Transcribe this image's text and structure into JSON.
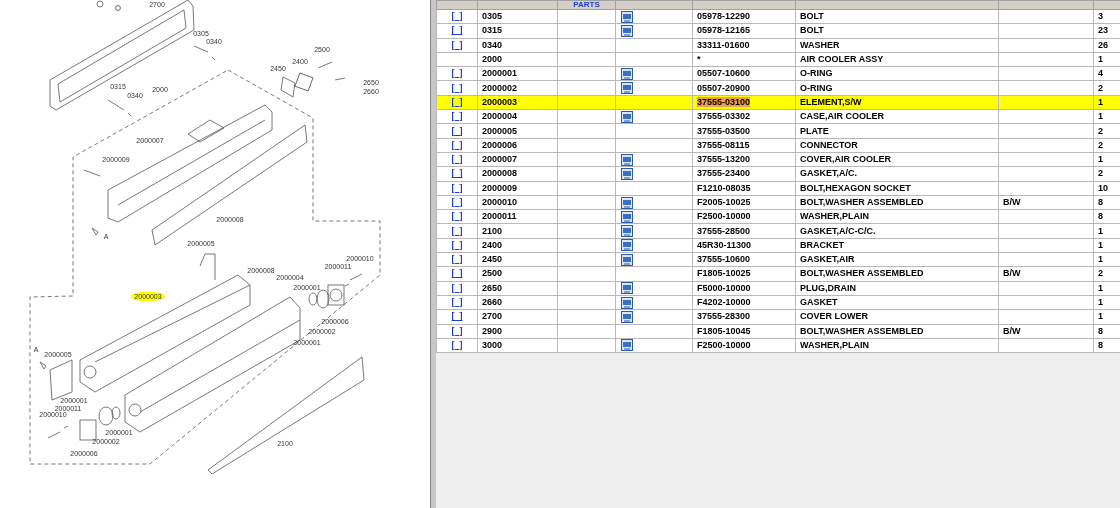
{
  "diagram": {
    "callouts": [
      {
        "label": "2700",
        "selected": false
      },
      {
        "label": "0305",
        "selected": false
      },
      {
        "label": "0340",
        "selected": false
      },
      {
        "label": "2500",
        "selected": false
      },
      {
        "label": "2400",
        "selected": false
      },
      {
        "label": "2450",
        "selected": false
      },
      {
        "label": "2650",
        "selected": false
      },
      {
        "label": "2660",
        "selected": false
      },
      {
        "label": "0315",
        "selected": false
      },
      {
        "label": "0340",
        "selected": false
      },
      {
        "label": "2000",
        "selected": false
      },
      {
        "label": "2000007",
        "selected": false
      },
      {
        "label": "2000009",
        "selected": false
      },
      {
        "label": "2000008",
        "selected": false
      },
      {
        "label": "A",
        "selected": false
      },
      {
        "label": "2000005",
        "selected": false
      },
      {
        "label": "2000010",
        "selected": false
      },
      {
        "label": "2000011",
        "selected": false
      },
      {
        "label": "2000008",
        "selected": false
      },
      {
        "label": "2000004",
        "selected": false
      },
      {
        "label": "2000001",
        "selected": false
      },
      {
        "label": "2000003",
        "selected": true
      },
      {
        "label": "2000006",
        "selected": false
      },
      {
        "label": "2000002",
        "selected": false
      },
      {
        "label": "2000001",
        "selected": false
      },
      {
        "label": "A",
        "selected": false
      },
      {
        "label": "2000005",
        "selected": false
      },
      {
        "label": "2000001",
        "selected": false
      },
      {
        "label": "2000011",
        "selected": false
      },
      {
        "label": "2000010",
        "selected": false
      },
      {
        "label": "2000001",
        "selected": false
      },
      {
        "label": "2000002",
        "selected": false
      },
      {
        "label": "2000006",
        "selected": false
      },
      {
        "label": "2100",
        "selected": false
      }
    ]
  },
  "table": {
    "header": {
      "column_3": "PARTS"
    },
    "rows": [
      {
        "link": "[  ]",
        "item": "0305",
        "has_doc": true,
        "part_no": "05978-12290",
        "name": "BOLT",
        "remark": "",
        "qty": "3",
        "selected": false
      },
      {
        "link": "[  ]",
        "item": "0315",
        "has_doc": true,
        "part_no": "05978-12165",
        "name": "BOLT",
        "remark": "",
        "qty": "23",
        "selected": false
      },
      {
        "link": "[  ]",
        "item": "0340",
        "has_doc": false,
        "part_no": "33311-01600",
        "name": "WASHER",
        "remark": "",
        "qty": "26",
        "selected": false
      },
      {
        "link": "",
        "item": "2000",
        "has_doc": false,
        "part_no": "*",
        "name": "AIR COOLER ASSY",
        "remark": "",
        "qty": "1",
        "selected": false
      },
      {
        "link": "[  ]",
        "item": "2000001",
        "has_doc": true,
        "part_no": "05507-10600",
        "name": "O-RING",
        "remark": "",
        "qty": "4",
        "selected": false
      },
      {
        "link": "[  ]",
        "item": "2000002",
        "has_doc": true,
        "part_no": "05507-20900",
        "name": "O-RING",
        "remark": "",
        "qty": "2",
        "selected": false
      },
      {
        "link": "[  ]",
        "item": "2000003",
        "has_doc": false,
        "part_no": "37555-03100",
        "name": "ELEMENT,S/W",
        "remark": "",
        "qty": "1",
        "selected": true
      },
      {
        "link": "[  ]",
        "item": "2000004",
        "has_doc": true,
        "part_no": "37555-03302",
        "name": "CASE,AIR COOLER",
        "remark": "",
        "qty": "1",
        "selected": false
      },
      {
        "link": "[  ]",
        "item": "2000005",
        "has_doc": false,
        "part_no": "37555-03500",
        "name": "PLATE",
        "remark": "",
        "qty": "2",
        "selected": false
      },
      {
        "link": "[  ]",
        "item": "2000006",
        "has_doc": false,
        "part_no": "37555-08115",
        "name": "CONNECTOR",
        "remark": "",
        "qty": "2",
        "selected": false
      },
      {
        "link": "[  ]",
        "item": "2000007",
        "has_doc": true,
        "part_no": "37555-13200",
        "name": "COVER,AIR COOLER",
        "remark": "",
        "qty": "1",
        "selected": false
      },
      {
        "link": "[  ]",
        "item": "2000008",
        "has_doc": true,
        "part_no": "37555-23400",
        "name": "GASKET,A/C.",
        "remark": "",
        "qty": "2",
        "selected": false
      },
      {
        "link": "[  ]",
        "item": "2000009",
        "has_doc": false,
        "part_no": "F1210-08035",
        "name": "BOLT,HEXAGON SOCKET",
        "remark": "",
        "qty": "10",
        "selected": false
      },
      {
        "link": "[  ]",
        "item": "2000010",
        "has_doc": true,
        "part_no": "F2005-10025",
        "name": "BOLT,WASHER ASSEMBLED",
        "remark": "B/W",
        "qty": "8",
        "selected": false
      },
      {
        "link": "[  ]",
        "item": "2000011",
        "has_doc": true,
        "part_no": "F2500-10000",
        "name": "WASHER,PLAIN",
        "remark": "",
        "qty": "8",
        "selected": false
      },
      {
        "link": "[  ]",
        "item": "2100",
        "has_doc": true,
        "part_no": "37555-28500",
        "name": "GASKET,A/C-C/C.",
        "remark": "",
        "qty": "1",
        "selected": false
      },
      {
        "link": "[  ]",
        "item": "2400",
        "has_doc": true,
        "part_no": "45R30-11300",
        "name": "BRACKET",
        "remark": "",
        "qty": "1",
        "selected": false
      },
      {
        "link": "[  ]",
        "item": "2450",
        "has_doc": true,
        "part_no": "37555-10600",
        "name": "GASKET,AIR",
        "remark": "",
        "qty": "1",
        "selected": false
      },
      {
        "link": "[  ]",
        "item": "2500",
        "has_doc": false,
        "part_no": "F1805-10025",
        "name": "BOLT,WASHER ASSEMBLED",
        "remark": "B/W",
        "qty": "2",
        "selected": false
      },
      {
        "link": "[  ]",
        "item": "2650",
        "has_doc": true,
        "part_no": "F5000-10000",
        "name": "PLUG,DRAIN",
        "remark": "",
        "qty": "1",
        "selected": false
      },
      {
        "link": "[  ]",
        "item": "2660",
        "has_doc": true,
        "part_no": "F4202-10000",
        "name": "GASKET",
        "remark": "",
        "qty": "1",
        "selected": false
      },
      {
        "link": "[  ]",
        "item": "2700",
        "has_doc": true,
        "part_no": "37555-28300",
        "name": "COVER LOWER",
        "remark": "",
        "qty": "1",
        "selected": false
      },
      {
        "link": "[  ]",
        "item": "2900",
        "has_doc": false,
        "part_no": "F1805-10045",
        "name": "BOLT,WASHER ASSEMBLED",
        "remark": "B/W",
        "qty": "8",
        "selected": false
      },
      {
        "link": "[  ]",
        "item": "3000",
        "has_doc": true,
        "part_no": "F2500-10000",
        "name": "WASHER,PLAIN",
        "remark": "",
        "qty": "8",
        "selected": false
      }
    ]
  }
}
